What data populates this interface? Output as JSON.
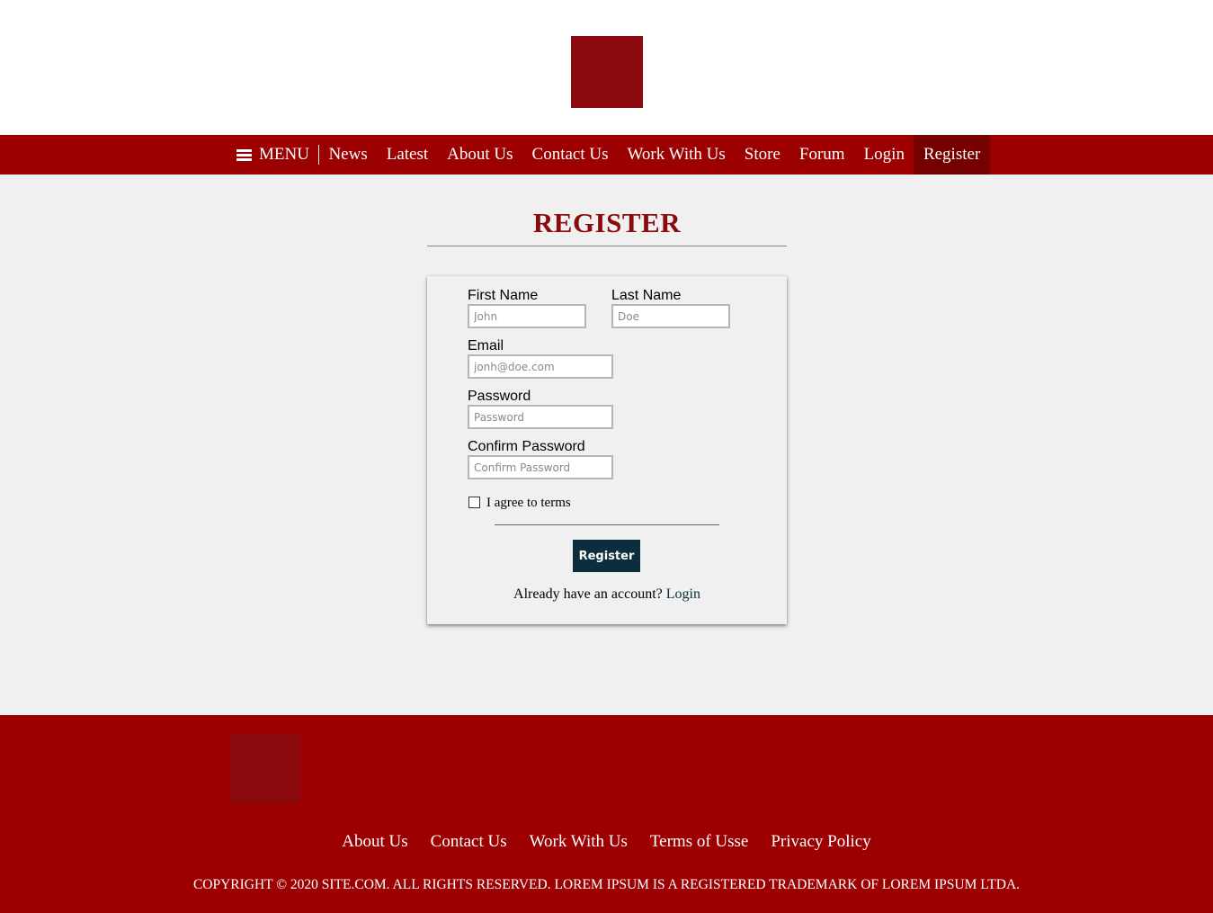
{
  "header": {
    "nav": {
      "menu_label": "MENU",
      "links": [
        "News",
        "Latest",
        "About Us",
        "Contact Us",
        "Work With Us",
        "Store",
        "Forum",
        "Login",
        "Register"
      ],
      "active": "Register"
    }
  },
  "main": {
    "title": "REGISTER",
    "form": {
      "first_name": {
        "label": "First Name",
        "placeholder": "John"
      },
      "last_name": {
        "label": "Last Name",
        "placeholder": "Doe"
      },
      "email": {
        "label": "Email",
        "placeholder": "jonh@doe.com"
      },
      "password": {
        "label": "Password",
        "placeholder": "Password"
      },
      "confirm_password": {
        "label": "Confirm Password",
        "placeholder": "Confirm Password"
      },
      "terms_label": "I agree to terms",
      "terms_checked": false,
      "submit_label": "Register",
      "already_text": "Already have an account?",
      "login_link": "Login"
    }
  },
  "footer": {
    "links": [
      "About Us",
      "Contact Us",
      "Work With Us",
      "Terms of Usse",
      "Privacy Policy"
    ],
    "copyright": "COPYRIGHT © 2020 SITE.COM. ALL RIGHTS RESERVED. LOREM IPSUM IS A REGISTERED TRADEMARK OF LOREM IPSUM LTDA."
  },
  "colors": {
    "brand_red": "#9d0000",
    "logo_red": "#8b0a0e",
    "active_nav": "#750000",
    "button_dark": "#0b2d3d",
    "background": "#f0f0f0"
  },
  "icons": {
    "menu": "hamburger-icon"
  }
}
